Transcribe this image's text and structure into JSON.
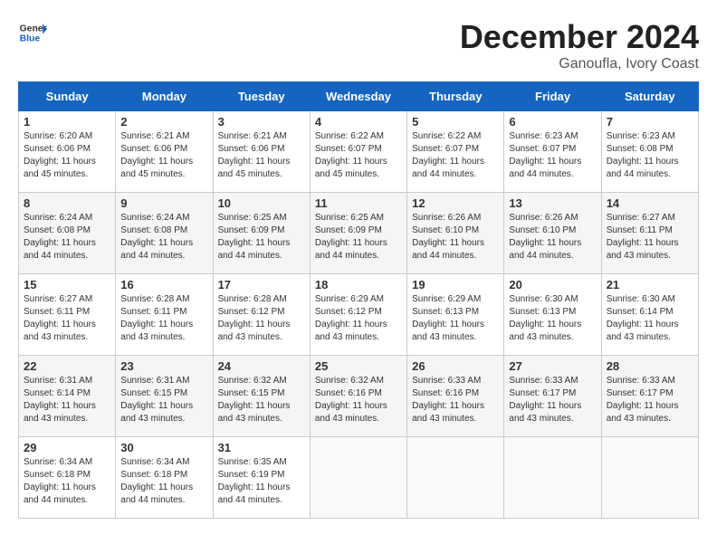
{
  "header": {
    "logo_line1": "General",
    "logo_line2": "Blue",
    "month": "December 2024",
    "location": "Ganoufla, Ivory Coast"
  },
  "days_of_week": [
    "Sunday",
    "Monday",
    "Tuesday",
    "Wednesday",
    "Thursday",
    "Friday",
    "Saturday"
  ],
  "weeks": [
    [
      {
        "day": "1",
        "info": "Sunrise: 6:20 AM\nSunset: 6:06 PM\nDaylight: 11 hours and 45 minutes."
      },
      {
        "day": "2",
        "info": "Sunrise: 6:21 AM\nSunset: 6:06 PM\nDaylight: 11 hours and 45 minutes."
      },
      {
        "day": "3",
        "info": "Sunrise: 6:21 AM\nSunset: 6:06 PM\nDaylight: 11 hours and 45 minutes."
      },
      {
        "day": "4",
        "info": "Sunrise: 6:22 AM\nSunset: 6:07 PM\nDaylight: 11 hours and 45 minutes."
      },
      {
        "day": "5",
        "info": "Sunrise: 6:22 AM\nSunset: 6:07 PM\nDaylight: 11 hours and 44 minutes."
      },
      {
        "day": "6",
        "info": "Sunrise: 6:23 AM\nSunset: 6:07 PM\nDaylight: 11 hours and 44 minutes."
      },
      {
        "day": "7",
        "info": "Sunrise: 6:23 AM\nSunset: 6:08 PM\nDaylight: 11 hours and 44 minutes."
      }
    ],
    [
      {
        "day": "8",
        "info": "Sunrise: 6:24 AM\nSunset: 6:08 PM\nDaylight: 11 hours and 44 minutes."
      },
      {
        "day": "9",
        "info": "Sunrise: 6:24 AM\nSunset: 6:08 PM\nDaylight: 11 hours and 44 minutes."
      },
      {
        "day": "10",
        "info": "Sunrise: 6:25 AM\nSunset: 6:09 PM\nDaylight: 11 hours and 44 minutes."
      },
      {
        "day": "11",
        "info": "Sunrise: 6:25 AM\nSunset: 6:09 PM\nDaylight: 11 hours and 44 minutes."
      },
      {
        "day": "12",
        "info": "Sunrise: 6:26 AM\nSunset: 6:10 PM\nDaylight: 11 hours and 44 minutes."
      },
      {
        "day": "13",
        "info": "Sunrise: 6:26 AM\nSunset: 6:10 PM\nDaylight: 11 hours and 44 minutes."
      },
      {
        "day": "14",
        "info": "Sunrise: 6:27 AM\nSunset: 6:11 PM\nDaylight: 11 hours and 43 minutes."
      }
    ],
    [
      {
        "day": "15",
        "info": "Sunrise: 6:27 AM\nSunset: 6:11 PM\nDaylight: 11 hours and 43 minutes."
      },
      {
        "day": "16",
        "info": "Sunrise: 6:28 AM\nSunset: 6:11 PM\nDaylight: 11 hours and 43 minutes."
      },
      {
        "day": "17",
        "info": "Sunrise: 6:28 AM\nSunset: 6:12 PM\nDaylight: 11 hours and 43 minutes."
      },
      {
        "day": "18",
        "info": "Sunrise: 6:29 AM\nSunset: 6:12 PM\nDaylight: 11 hours and 43 minutes."
      },
      {
        "day": "19",
        "info": "Sunrise: 6:29 AM\nSunset: 6:13 PM\nDaylight: 11 hours and 43 minutes."
      },
      {
        "day": "20",
        "info": "Sunrise: 6:30 AM\nSunset: 6:13 PM\nDaylight: 11 hours and 43 minutes."
      },
      {
        "day": "21",
        "info": "Sunrise: 6:30 AM\nSunset: 6:14 PM\nDaylight: 11 hours and 43 minutes."
      }
    ],
    [
      {
        "day": "22",
        "info": "Sunrise: 6:31 AM\nSunset: 6:14 PM\nDaylight: 11 hours and 43 minutes."
      },
      {
        "day": "23",
        "info": "Sunrise: 6:31 AM\nSunset: 6:15 PM\nDaylight: 11 hours and 43 minutes."
      },
      {
        "day": "24",
        "info": "Sunrise: 6:32 AM\nSunset: 6:15 PM\nDaylight: 11 hours and 43 minutes."
      },
      {
        "day": "25",
        "info": "Sunrise: 6:32 AM\nSunset: 6:16 PM\nDaylight: 11 hours and 43 minutes."
      },
      {
        "day": "26",
        "info": "Sunrise: 6:33 AM\nSunset: 6:16 PM\nDaylight: 11 hours and 43 minutes."
      },
      {
        "day": "27",
        "info": "Sunrise: 6:33 AM\nSunset: 6:17 PM\nDaylight: 11 hours and 43 minutes."
      },
      {
        "day": "28",
        "info": "Sunrise: 6:33 AM\nSunset: 6:17 PM\nDaylight: 11 hours and 43 minutes."
      }
    ],
    [
      {
        "day": "29",
        "info": "Sunrise: 6:34 AM\nSunset: 6:18 PM\nDaylight: 11 hours and 44 minutes."
      },
      {
        "day": "30",
        "info": "Sunrise: 6:34 AM\nSunset: 6:18 PM\nDaylight: 11 hours and 44 minutes."
      },
      {
        "day": "31",
        "info": "Sunrise: 6:35 AM\nSunset: 6:19 PM\nDaylight: 11 hours and 44 minutes."
      },
      null,
      null,
      null,
      null
    ]
  ]
}
